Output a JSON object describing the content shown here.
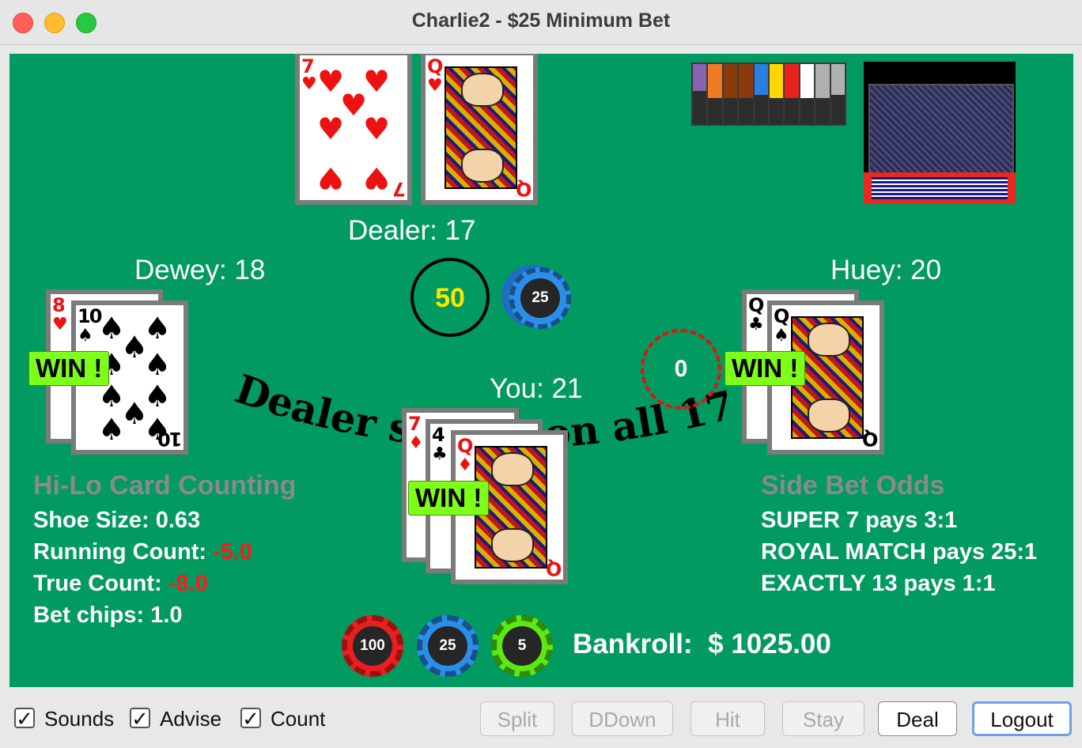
{
  "window": {
    "title": "Charlie2 - $25 Minimum Bet"
  },
  "dealer": {
    "label": "Dealer: 17",
    "cards": [
      {
        "rank": "7",
        "suit": "hearts",
        "color": "red"
      },
      {
        "rank": "Q",
        "suit": "hearts",
        "color": "red"
      }
    ],
    "bet": "50",
    "chip": "25"
  },
  "players": {
    "dewey": {
      "label": "Dewey: 18",
      "result": "WIN !",
      "cards": [
        {
          "rank": "8",
          "suit": "hearts",
          "color": "red"
        },
        {
          "rank": "10",
          "suit": "spades",
          "color": "black"
        }
      ]
    },
    "you": {
      "label": "You: 21",
      "result": "WIN !",
      "cards": [
        {
          "rank": "7",
          "suit": "diamonds",
          "color": "red"
        },
        {
          "rank": "4",
          "suit": "clubs",
          "color": "black"
        },
        {
          "rank": "Q",
          "suit": "diamonds",
          "color": "red"
        }
      ]
    },
    "huey": {
      "label": "Huey: 20",
      "result": "WIN !",
      "cards": [
        {
          "rank": "Q",
          "suit": "clubs",
          "color": "black"
        },
        {
          "rank": "Q",
          "suit": "spades",
          "color": "black"
        }
      ]
    }
  },
  "side_bet": {
    "value": "0"
  },
  "table_text": "Dealer stands on all 17",
  "shoe_indicator": {
    "colors": [
      "#8a63b0",
      "#f07a22",
      "#8b3a0c",
      "#8b3a0c",
      "#2a7fe0",
      "#ffd700",
      "#e8231e",
      "#ffffff",
      "#b0b0b0",
      "#b0b0b0"
    ],
    "fill_fraction": [
      0.75,
      0.95,
      0.95,
      0.95,
      0.85,
      0.95,
      0.95,
      0.95,
      0.95,
      0.85
    ]
  },
  "counting": {
    "title": "Hi-Lo Card Counting",
    "shoe_size_label": "Shoe Size:",
    "shoe_size": "0.63",
    "running_count_label": "Running Count:",
    "running_count": "-5.0",
    "true_count_label": "True Count:",
    "true_count": "-8.0",
    "bet_chips_label": "Bet chips:",
    "bet_chips": "1.0"
  },
  "odds": {
    "title": "Side Bet Odds",
    "lines": [
      "SUPER 7 pays 3:1",
      "ROYAL MATCH pays 25:1",
      "EXACTLY 13 pays 1:1"
    ]
  },
  "chips": [
    {
      "value": "100",
      "color": "#e82020"
    },
    {
      "value": "25",
      "color": "#2b8fe8"
    },
    {
      "value": "5",
      "color": "#5ee812"
    }
  ],
  "bankroll": {
    "label": "Bankroll:",
    "amount": "$ 1025.00"
  },
  "options": {
    "sounds": {
      "label": "Sounds",
      "checked": "✓"
    },
    "advise": {
      "label": "Advise",
      "checked": "✓"
    },
    "count": {
      "label": "Count",
      "checked": "✓"
    }
  },
  "buttons": {
    "split": "Split",
    "ddown": "DDown",
    "hit": "Hit",
    "stay": "Stay",
    "deal": "Deal",
    "logout": "Logout"
  }
}
